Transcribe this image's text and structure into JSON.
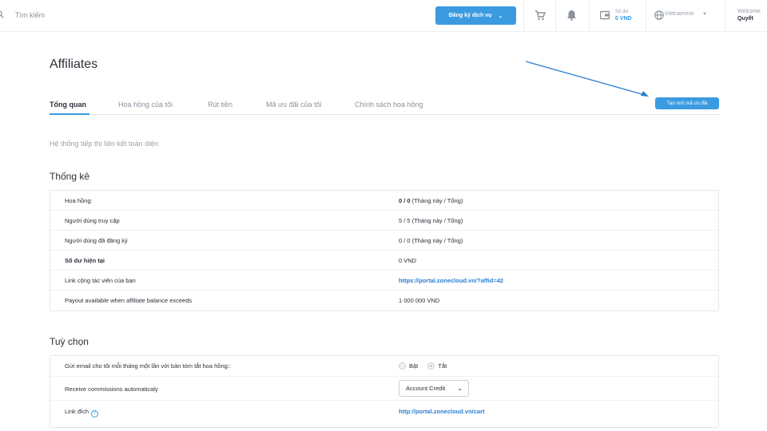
{
  "header": {
    "search_placeholder": "Tìm kiếm",
    "register_button": "Đăng ký dịch vụ",
    "balance_label": "Số dư",
    "balance_value": "0 VND",
    "language": "Vietnamese",
    "welcome_label": "Welcome",
    "user_name": "Quyết",
    "icons": [
      "search-icon",
      "cart-icon",
      "bell-icon",
      "wallet-icon",
      "globe-icon"
    ]
  },
  "page": {
    "title": "Affiliates",
    "create_button": "Tạo mới mã ưu đãi",
    "tabs": [
      {
        "label": "Tổng quan",
        "active": true
      },
      {
        "label": "Hoa hồng của tôi",
        "active": false
      },
      {
        "label": "Rút tiền",
        "active": false
      },
      {
        "label": "Mã ưu đãi của tôi",
        "active": false
      },
      {
        "label": "Chính sách hoa hồng",
        "active": false
      }
    ],
    "intro": "Hệ thống tiếp thị liên kết toàn diện"
  },
  "stats": {
    "title": "Thống kê",
    "rows": [
      {
        "label": "Hoa hồng:",
        "value_bold": "0 / 0",
        "value_rest": " (Tháng này / Tổng)"
      },
      {
        "label": "Người dùng truy cập",
        "value": "5 / 5 (Tháng này / Tổng)"
      },
      {
        "label": "Người dùng đã đăng ký",
        "value": "0 / 0 (Tháng này / Tổng)"
      },
      {
        "label": "Số dư hiện tại",
        "value": "0 VND"
      },
      {
        "label": "Link cộng tác viên của bạn",
        "value": "https://portal.zonecloud.vn/?affid=42"
      },
      {
        "label": "Payout available when affiliate balance exceeds",
        "value": "1 000 000 VND"
      }
    ]
  },
  "options": {
    "title": "Tuỳ chọn",
    "email_label": "Gửi email cho tôi mỗi tháng một lần với bản tóm tắt hoa hồng::",
    "radio_on": "Bật",
    "radio_off": "Tắt",
    "auto_label": "Receive commissions automaticaly",
    "auto_select": "Account Credit",
    "link_label": "Link đích",
    "link_value": "http://portal.zonecloud.vn/cart"
  },
  "colors": {
    "accent": "#3b9be0",
    "link": "#2a7fd1",
    "muted": "#8a919b"
  }
}
